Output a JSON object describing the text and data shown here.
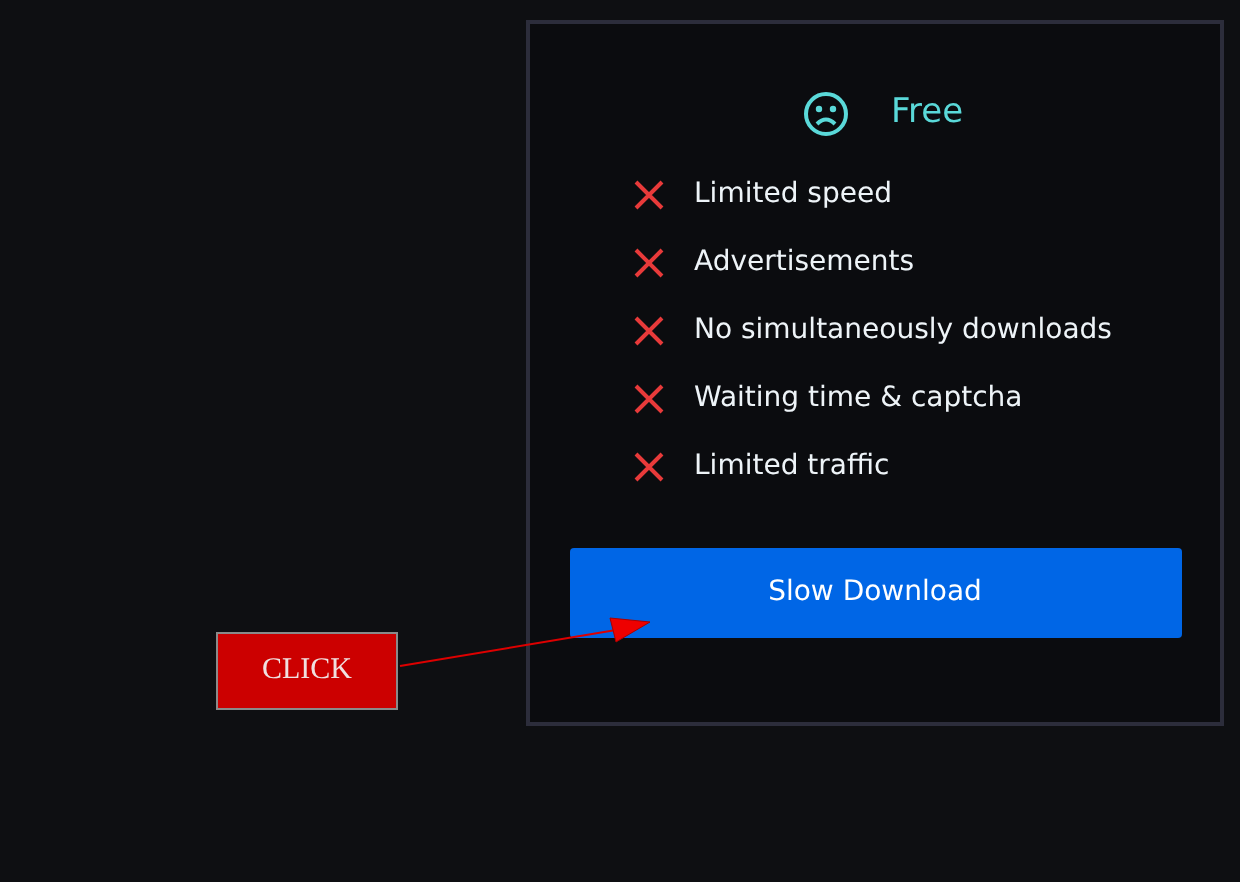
{
  "plan": {
    "title": "Free",
    "features": [
      {
        "label": "Limited speed",
        "included": false
      },
      {
        "label": "Advertisements",
        "included": false
      },
      {
        "label": "No simultaneously downloads",
        "included": false
      },
      {
        "label": "Waiting time & captcha",
        "included": false
      },
      {
        "label": "Limited traffic",
        "included": false
      }
    ],
    "button": "Slow Download"
  },
  "annotation": {
    "label": "CLICK"
  }
}
